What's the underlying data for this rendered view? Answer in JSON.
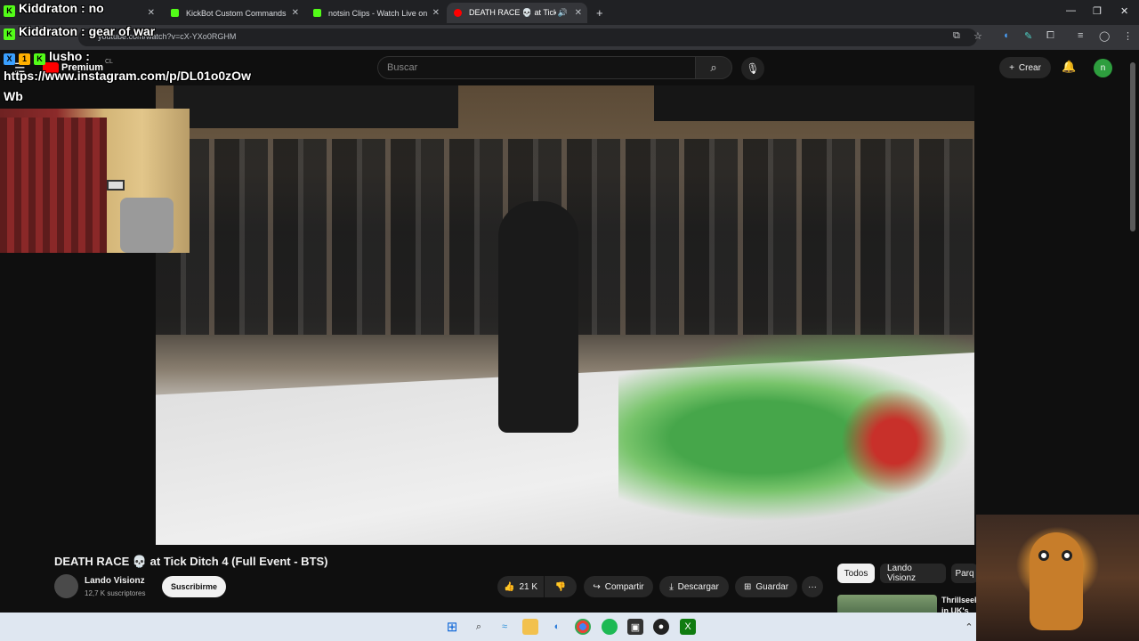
{
  "browser": {
    "tabs": [
      {
        "label": "",
        "active": false
      },
      {
        "label": "KickBot Custom Commands",
        "active": false
      },
      {
        "label": "notsin Clips - Watch Live on Ki",
        "active": false
      },
      {
        "label": "DEATH RACE 💀 at Tick Dit",
        "active": true
      }
    ],
    "url": "youtube.com/watch?v=cX-YXo0RGHM",
    "new_tab": "+",
    "window_controls": [
      "—",
      "❐",
      "✕"
    ]
  },
  "youtube": {
    "premium_label": "Premium",
    "country": "CL",
    "search_placeholder": "Buscar",
    "create_label": "Crear",
    "avatar_initial": "n"
  },
  "video": {
    "title": "DEATH RACE 💀 at Tick Ditch 4 (Full Event - BTS)",
    "channel_name": "Lando Visionz",
    "subscribers": "12,7 K suscriptores",
    "subscribe_label": "Suscribirme",
    "likes": "21 K",
    "share_label": "Compartir",
    "download_label": "Descargar",
    "save_label": "Guardar",
    "more_label": "···"
  },
  "sidebar": {
    "chips": [
      "Todos",
      "Lando Visionz",
      "Parq"
    ],
    "rec_title": "Thrillseek in UK's Cl"
  },
  "chat_overlay": [
    {
      "user": "Kiddraton",
      "message": "no"
    },
    {
      "user": "Kiddraton",
      "message": "gear of war"
    },
    {
      "user": "lusho",
      "message": ""
    },
    {
      "user": "",
      "message": "https://www.instagram.com/p/DL01o0zOw"
    },
    {
      "user": "",
      "message": "Wb"
    }
  ],
  "colors": {
    "background": "#0f0f0f",
    "kick_green": "#53fc18",
    "yt_red": "#ff0000",
    "avatar_green": "#2e9e3e"
  }
}
